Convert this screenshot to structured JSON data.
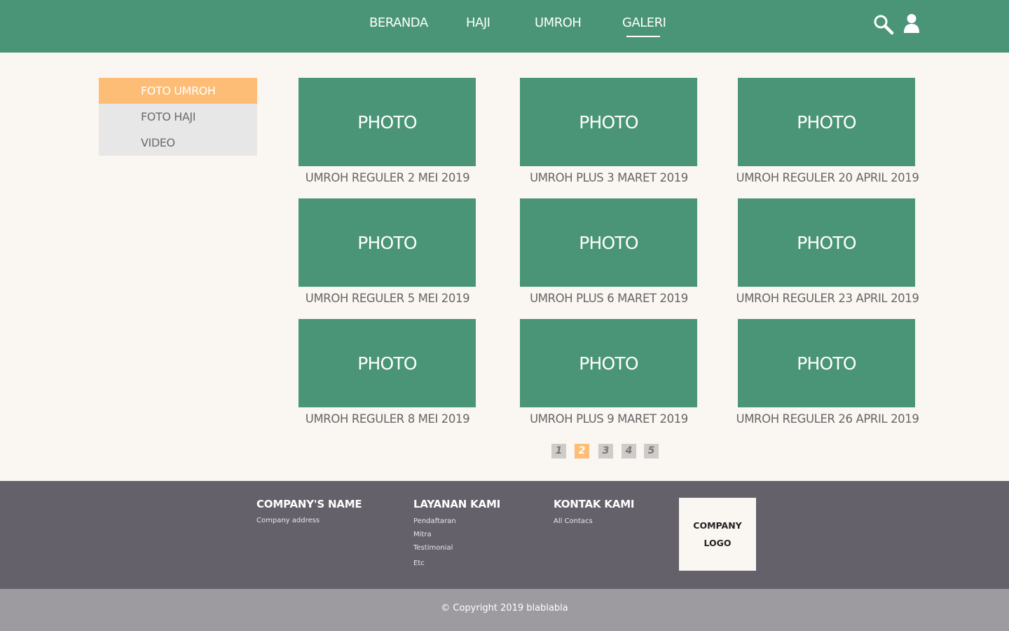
{
  "nav": {
    "items": [
      {
        "label": "BERANDA"
      },
      {
        "label": "HAJI"
      },
      {
        "label": "UMROH"
      },
      {
        "label": "GALERI",
        "active": true
      }
    ],
    "icons": [
      "search-icon",
      "user-icon"
    ]
  },
  "sidebar": {
    "items": [
      {
        "label": "FOTO UMROH",
        "active": true
      },
      {
        "label": "FOTO HAJI"
      },
      {
        "label": "VIDEO"
      }
    ]
  },
  "gallery": {
    "cards": [
      {
        "photo": "PHOTO",
        "caption": "UMROH REGULER 2 MEI 2019"
      },
      {
        "photo": "PHOTO",
        "caption": "UMROH PLUS 3 MARET 2019"
      },
      {
        "photo": "PHOTO",
        "caption": "UMROH REGULER 20 APRIL 2019"
      },
      {
        "photo": "PHOTO",
        "caption": "UMROH REGULER 5 MEI 2019"
      },
      {
        "photo": "PHOTO",
        "caption": "UMROH PLUS 6 MARET 2019"
      },
      {
        "photo": "PHOTO",
        "caption": "UMROH REGULER 23 APRIL 2019"
      },
      {
        "photo": "PHOTO",
        "caption": "UMROH REGULER 8 MEI 2019"
      },
      {
        "photo": "PHOTO",
        "caption": "UMROH PLUS 9 MARET 2019"
      },
      {
        "photo": "PHOTO",
        "caption": "UMROH REGULER 26 APRIL 2019"
      }
    ]
  },
  "pagination": {
    "pages": [
      "1",
      "2",
      "3",
      "4",
      "5"
    ],
    "current": "2"
  },
  "footer": {
    "company": {
      "title": "COMPANY'S NAME",
      "address": "Company address"
    },
    "services": {
      "title": "LAYANAN KAMI",
      "links": [
        "Pendaftaran",
        "Mitra",
        "Testimonial",
        "Etc"
      ]
    },
    "contact": {
      "title": "KONTAK KAMI",
      "links": [
        "All Contacs"
      ]
    },
    "logo": {
      "line1": "COMPANY",
      "line2": "LOGO"
    }
  },
  "copyright": "© Copyright 2019 blablabla",
  "colors": {
    "primary": "#4a9577",
    "accent": "#fdbd76",
    "background": "#faf6f2",
    "footer": "#64616b",
    "copyright_bar": "#9d9aa0"
  }
}
